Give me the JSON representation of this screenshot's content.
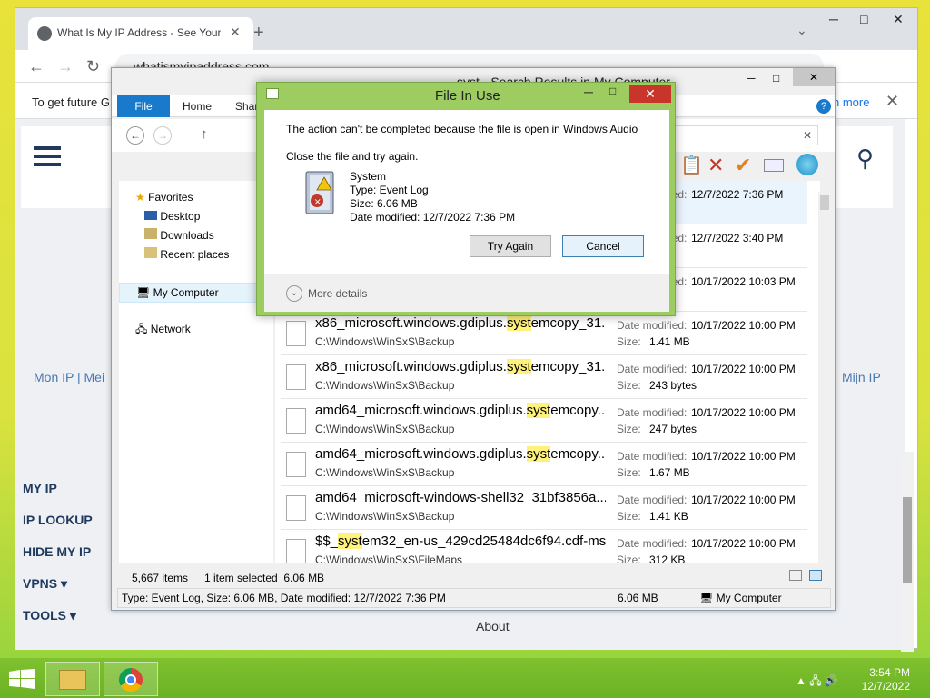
{
  "desktop": {
    "colors": {
      "accent": "#6bb224",
      "dialog_frame": "#9dcc61",
      "file_tab": "#1979ca"
    }
  },
  "chrome": {
    "tab_title": "What Is My IP Address - See Your",
    "tab_close": "✕",
    "new_tab": "+",
    "tab_search": "⌄",
    "win_min": "─",
    "win_max": "□",
    "win_close": "✕",
    "back": "←",
    "forward": "→",
    "reload": "↻",
    "url": "whatismyipaddress.com",
    "infobar_text": "To get future G",
    "infobar_more": "n more",
    "infobar_close": "✕"
  },
  "site": {
    "mon_ip": "Mon IP | Mei",
    "mijn_ip": "Mijn IP",
    "nav": [
      "MY IP",
      "IP LOOKUP",
      "HIDE MY IP",
      "VPNS ▾",
      "TOOLS ▾"
    ],
    "about": "About"
  },
  "explorer": {
    "title": "syst - Search Results in My Computer",
    "tabs": {
      "file": "File",
      "home": "Home",
      "share": "Shar"
    },
    "search_close": "✕",
    "nav": {
      "favorites": "Favorites",
      "desktop": "Desktop",
      "downloads": "Downloads",
      "recent": "Recent places",
      "mycomputer": "My Computer",
      "network": "Network"
    },
    "date_label": "Date modified:",
    "size_label": "Size:",
    "partial_top": [
      {
        "date": "12/7/2022 7:36 PM"
      },
      {
        "date": "12/7/2022 3:40 PM"
      },
      {
        "date": "10/17/2022 10:03 PM"
      }
    ],
    "rows": [
      {
        "pre": "x86_microsoft.windows.gdiplus.",
        "hl": "syst",
        "post": "emcopy_31...",
        "path": "C:\\Windows\\WinSxS\\Backup",
        "date": "10/17/2022 10:00 PM",
        "size": "1.41 MB"
      },
      {
        "pre": "x86_microsoft.windows.gdiplus.",
        "hl": "syst",
        "post": "emcopy_31...",
        "path": "C:\\Windows\\WinSxS\\Backup",
        "date": "10/17/2022 10:00 PM",
        "size": "243 bytes"
      },
      {
        "pre": "amd64_microsoft.windows.gdiplus.",
        "hl": "syst",
        "post": "emcopy...",
        "path": "C:\\Windows\\WinSxS\\Backup",
        "date": "10/17/2022 10:00 PM",
        "size": "247 bytes"
      },
      {
        "pre": "amd64_microsoft.windows.gdiplus.",
        "hl": "syst",
        "post": "emcopy...",
        "path": "C:\\Windows\\WinSxS\\Backup",
        "date": "10/17/2022 10:00 PM",
        "size": "1.67 MB"
      },
      {
        "pre": "amd64_microsoft-windows-shell32_31bf3856a...",
        "hl": "",
        "post": "",
        "path": "C:\\Windows\\WinSxS\\Backup",
        "date": "10/17/2022 10:00 PM",
        "size": "1.41 KB"
      },
      {
        "pre": "$$_",
        "hl": "syst",
        "post": "em32_en-us_429cd25484dc6f94.cdf-ms",
        "path": "C:\\Windows\\WinSxS\\FileMaps",
        "date": "10/17/2022 10:00 PM",
        "size": "312 KB"
      }
    ],
    "status": {
      "items": "5,667 items",
      "selected": "1 item selected  6.06 MB"
    },
    "details_bar": {
      "info": "Type: Event Log, Size: 6.06 MB, Date modified: 12/7/2022 7:36 PM",
      "size": "6.06 MB",
      "location": "My Computer"
    }
  },
  "dialog": {
    "title": "File In Use",
    "message": "The action can't be completed because the file is open in Windows Audio",
    "instruction": "Close the file and try again.",
    "file": {
      "name": "System",
      "type": "Type: Event Log",
      "size": "Size: 6.06 MB",
      "date": "Date modified: 12/7/2022 7:36 PM"
    },
    "try_again": "Try Again",
    "cancel": "Cancel",
    "more_details": "More details",
    "min": "─",
    "max": "□",
    "close": "✕"
  },
  "taskbar": {
    "time": "3:54 PM",
    "date": "12/7/2022",
    "tray": "▲ 🖧 🔊"
  }
}
